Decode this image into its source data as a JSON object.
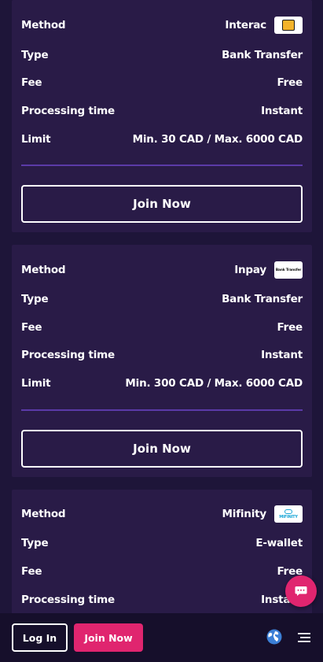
{
  "labels": {
    "method": "Method",
    "type": "Type",
    "fee": "Fee",
    "processing_time": "Processing time",
    "limit": "Limit"
  },
  "cards": [
    {
      "method": "Interac",
      "logo_icon": "interac-logo-icon",
      "type": "Bank Transfer",
      "fee": "Free",
      "processing_time": "Instant",
      "limit": "Min. 30 CAD / Max. 6000 CAD",
      "button": "Join Now"
    },
    {
      "method": "Inpay",
      "logo_icon": "inpay-logo-icon",
      "logo_text": "Bank Transfer",
      "type": "Bank Transfer",
      "fee": "Free",
      "processing_time": "Instant",
      "limit": "Min. 300 CAD / Max. 6000 CAD",
      "button": "Join Now"
    },
    {
      "method": "Mifinity",
      "logo_icon": "mifinity-logo-icon",
      "logo_text": "MIFINITY",
      "type": "E-wallet",
      "fee": "Free",
      "processing_time": "Instant"
    }
  ],
  "bottom_nav": {
    "login_label": "Log In",
    "join_label": "Join Now",
    "language_icon": "globe-icon",
    "menu_icon": "hamburger-menu-icon"
  },
  "chat_icon": "chat-bubble-icon",
  "colors": {
    "page_bg": "#1e1539",
    "card_bg": "#291b47",
    "divider": "#5b3aa8",
    "accent_pink": "#e0256f",
    "bottom_bar_bg": "#160f2b"
  }
}
